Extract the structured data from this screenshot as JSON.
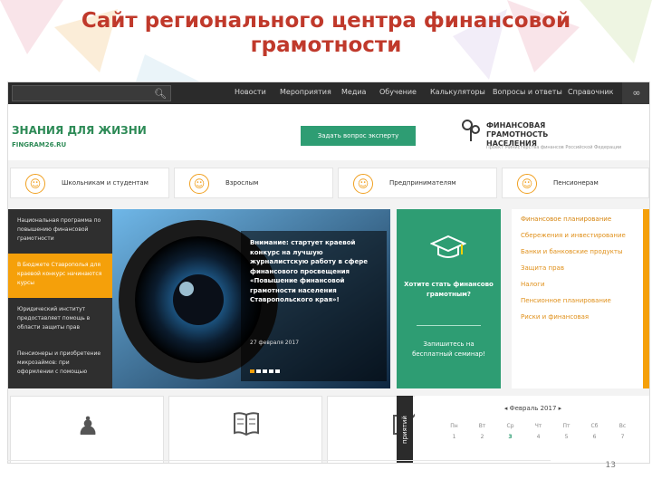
{
  "slide": {
    "title_line1": "Сайт регионального центра финансовой",
    "title_line2": "грамотности",
    "page_number": "13"
  },
  "nav": {
    "search_icon": "search-icon",
    "items": [
      "Новости",
      "Мероприятия",
      "Медиа",
      "Обучение",
      "Калькуляторы",
      "Вопросы и ответы",
      "Справочник"
    ],
    "end_icon": "glasses-icon"
  },
  "header": {
    "logo_main": "ЗНАНИЯ ДЛЯ ЖИЗНИ",
    "logo_sub": "FINGRAM26.RU",
    "ask_button": "Задать вопрос эксперту",
    "brand_name": "ФИНАНСОВАЯ ГРАМОТНОСТЬ НАСЕЛЕНИЯ",
    "brand_tagline": "Проект Министерства финансов Российской Федерации"
  },
  "audiences": [
    {
      "label": "Школьникам и студентам",
      "icon": "student-icon"
    },
    {
      "label": "Взрослым",
      "icon": "adult-icon"
    },
    {
      "label": "Предпринимателям",
      "icon": "entrepreneur-icon"
    },
    {
      "label": "Пенсионерам",
      "icon": "pensioner-icon"
    }
  ],
  "news": [
    {
      "text": "Национальная программа по повышению финансовой грамотности",
      "active": false
    },
    {
      "text": "В Бюджете Ставрополья для краевой конкурс начинаются курсы",
      "active": true
    },
    {
      "text": "Юридический институт предоставляет помощь в области защиты прав",
      "active": false
    },
    {
      "text": "Пенсионеры и приобретение микрозаймов: при оформлении с помощью",
      "active": false
    }
  ],
  "hero": {
    "text": "Внимание: стартует краевой конкурс на лучшую журналистскую работу в сфере финансового просвещения «Повышение финансовой грамотности населения Ставропольского края»!",
    "date": "27 февраля 2017"
  },
  "green_card": {
    "icon": "graduation-cap-icon",
    "question": "Хотите стать финансово грамотным?",
    "link": "Запишитесь на бесплатный семинар!"
  },
  "topics": [
    "Финансовое планирование",
    "Сбережения и инвестирование",
    "Банки и банковские продукты",
    "Защита прав",
    "Налоги",
    "Пенсионное планирование",
    "Риски и финансовая"
  ],
  "bottom_cards": [
    {
      "icon": "pawn-icon"
    },
    {
      "icon": "book-icon"
    },
    {
      "icon": "checkbox-icon"
    }
  ],
  "side_tab": "приятий",
  "calendar": {
    "month": "Февраль 2017",
    "weekdays": [
      "Пн",
      "Вт",
      "Ср",
      "Чт",
      "Пт",
      "Сб",
      "Вс"
    ],
    "week": [
      "1",
      "2",
      "3",
      "4",
      "5",
      "6",
      "7"
    ]
  },
  "colors": {
    "title": "#c0392b",
    "accent_green": "#2e9d73",
    "accent_orange": "#f5a00a",
    "navbar": "#2b2b2b"
  }
}
